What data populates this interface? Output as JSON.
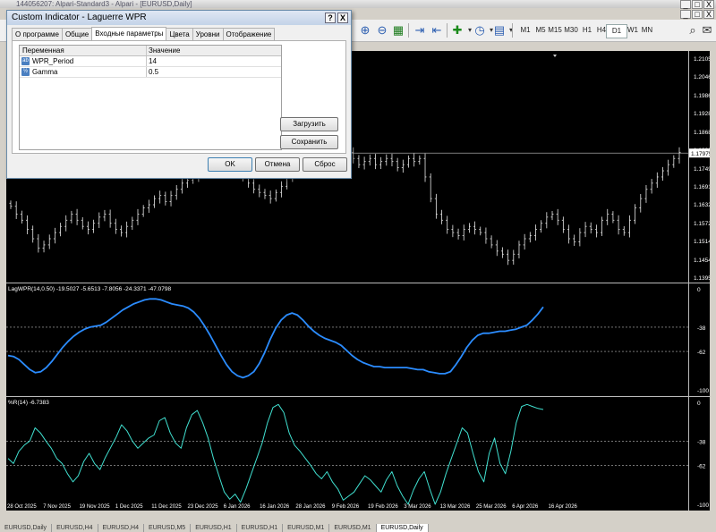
{
  "window": {
    "title": "144056207: Alpari-Standard3 - Alpari - [EURUSD,Daily]",
    "buttons": [
      "_",
      "□",
      "X"
    ]
  },
  "mdi_buttons": [
    "_",
    "□",
    "X"
  ],
  "toolbar": {
    "timeframes": [
      "M1",
      "M5",
      "M15",
      "M30",
      "H1",
      "H4",
      "D1",
      "W1",
      "MN"
    ],
    "active_timeframe": "D1"
  },
  "dialog": {
    "title": "Custom Indicator - Laguerre WPR",
    "help_label": "?",
    "close_label": "X",
    "tabs": [
      "О программе",
      "Общие",
      "Входные параметры",
      "Цвета",
      "Уровни",
      "Отображение"
    ],
    "active_tab": "Входные параметры",
    "grid": {
      "col_variable": "Переменная",
      "col_value": "Значение",
      "rows": [
        {
          "name": "WPR_Period",
          "value": "14"
        },
        {
          "name": "Gamma",
          "value": "0.5"
        }
      ]
    },
    "load_label": "Загрузить",
    "save_label": "Сохранить",
    "ok_label": "OK",
    "cancel_label": "Отмена",
    "reset_label": "Сброс"
  },
  "chart_data": [
    {
      "type": "bar",
      "symbol": "EURUSD",
      "timeframe": "Daily",
      "price_scale": [
        "1.21050",
        "1.20465",
        "1.19865",
        "1.19280",
        "1.18680",
        "1.18095",
        "1.17495",
        "1.16910",
        "1.16325",
        "1.15725",
        "1.15140",
        "1.14540",
        "1.13955"
      ],
      "ylim": [
        1.13955,
        1.2105
      ],
      "current_price": "1.17975",
      "bid_level": "1.18095",
      "x_labels": [
        "28 Oct 2025",
        "7 Nov 2025",
        "19 Nov 2025",
        "1 Dec 2025",
        "11 Dec 2025",
        "23 Dec 2025",
        "6 Jan 2026",
        "16 Jan 2026",
        "28 Jan 2026",
        "9 Feb 2026",
        "19 Feb 2026",
        "3 Mar 2026",
        "13 Mar 2026",
        "25 Mar 2026",
        "6 Apr 2026",
        "16 Apr 2026"
      ],
      "close": [
        1.1625,
        1.16,
        1.158,
        1.155,
        1.152,
        1.149,
        1.15,
        1.152,
        1.154,
        1.156,
        1.158,
        1.16,
        1.158,
        1.156,
        1.155,
        1.157,
        1.159,
        1.16,
        1.157,
        1.155,
        1.154,
        1.156,
        1.158,
        1.16,
        1.162,
        1.163,
        1.165,
        1.166,
        1.164,
        1.166,
        1.168,
        1.17,
        1.171,
        1.172,
        1.174,
        1.175,
        1.174,
        1.176,
        1.177,
        1.176,
        1.175,
        1.173,
        1.172,
        1.17,
        1.168,
        1.167,
        1.166,
        1.165,
        1.167,
        1.169,
        1.172,
        1.174,
        1.175,
        1.176,
        1.178,
        1.18,
        1.182,
        1.185,
        1.187,
        1.186,
        1.183,
        1.18,
        1.178,
        1.176,
        1.177,
        1.178,
        1.176,
        1.177,
        1.178,
        1.177,
        1.175,
        1.176,
        1.178,
        1.177,
        1.178,
        1.172,
        1.165,
        1.16,
        1.158,
        1.155,
        1.154,
        1.153,
        1.155,
        1.156,
        1.155,
        1.154,
        1.152,
        1.15,
        1.148,
        1.147,
        1.145,
        1.147,
        1.15,
        1.152,
        1.153,
        1.155,
        1.157,
        1.159,
        1.16,
        1.158,
        1.155,
        1.152,
        1.151,
        1.154,
        1.156,
        1.155,
        1.154,
        1.158,
        1.16,
        1.158,
        1.155,
        1.154,
        1.158,
        1.162,
        1.165,
        1.168,
        1.17,
        1.172,
        1.174,
        1.176,
        1.178,
        1.18
      ]
    },
    {
      "type": "line",
      "label": "LagWPR(14,0.50) -19.5027 -5.6513 -7.8056 -24.3371 -47.0798",
      "levels": [
        -38,
        -62
      ],
      "scale": [
        "0",
        "-38",
        "-62",
        "-100"
      ],
      "ylim": [
        -100,
        0
      ],
      "y": [
        -66,
        -67,
        -70,
        -75,
        -80,
        -83,
        -82,
        -78,
        -72,
        -65,
        -58,
        -52,
        -47,
        -43,
        -40,
        -38,
        -37,
        -36,
        -33,
        -29,
        -25,
        -21,
        -18,
        -15,
        -13,
        -11,
        -10,
        -10,
        -11,
        -13,
        -15,
        -16,
        -17,
        -19,
        -23,
        -29,
        -37,
        -46,
        -56,
        -66,
        -75,
        -82,
        -86,
        -88,
        -86,
        -82,
        -74,
        -63,
        -50,
        -39,
        -31,
        -26,
        -24,
        -26,
        -31,
        -37,
        -42,
        -46,
        -49,
        -51,
        -53,
        -56,
        -61,
        -66,
        -70,
        -73,
        -75,
        -77,
        -77,
        -78,
        -78,
        -78,
        -78,
        -78,
        -79,
        -80,
        -80,
        -82,
        -83,
        -84,
        -84,
        -82,
        -75,
        -67,
        -58,
        -51,
        -46,
        -44,
        -44,
        -43,
        -42,
        -42,
        -41,
        -40,
        -38,
        -36,
        -31,
        -25,
        -18
      ]
    },
    {
      "type": "line",
      "label": "%R(14) -6.7383",
      "levels": [
        -38,
        -62
      ],
      "scale": [
        "0",
        "-38",
        "-62",
        "-100"
      ],
      "ylim": [
        -100,
        0
      ],
      "y": [
        -55,
        -60,
        -48,
        -42,
        -38,
        -25,
        -30,
        -38,
        -45,
        -55,
        -60,
        -70,
        -78,
        -72,
        -58,
        -50,
        -60,
        -66,
        -54,
        -44,
        -34,
        -22,
        -28,
        -38,
        -45,
        -40,
        -35,
        -32,
        -18,
        -15,
        -30,
        -40,
        -45,
        -25,
        -12,
        -8,
        -20,
        -35,
        -55,
        -72,
        -88,
        -95,
        -90,
        -98,
        -85,
        -70,
        -55,
        -40,
        -20,
        -5,
        -2,
        -10,
        -30,
        -42,
        -48,
        -55,
        -62,
        -70,
        -75,
        -68,
        -78,
        -85,
        -96,
        -92,
        -88,
        -80,
        -72,
        -76,
        -82,
        -88,
        -76,
        -68,
        -82,
        -92,
        -100,
        -86,
        -75,
        -68,
        -85,
        -100,
        -88,
        -70,
        -55,
        -40,
        -25,
        -30,
        -50,
        -68,
        -78,
        -50,
        -35,
        -60,
        -70,
        -48,
        -20,
        -4,
        -2,
        -4,
        -6,
        -7
      ]
    }
  ],
  "bottom_tabs": [
    "EURUSD,Daily",
    "EURUSD,H4",
    "EURUSD,H4",
    "EURUSD,M5",
    "EURUSD,H1",
    "EURUSD,H1",
    "EURUSD,M1",
    "EURUSD,M1",
    "EURUSD,Daily"
  ],
  "active_bottom_tab_index": 8
}
